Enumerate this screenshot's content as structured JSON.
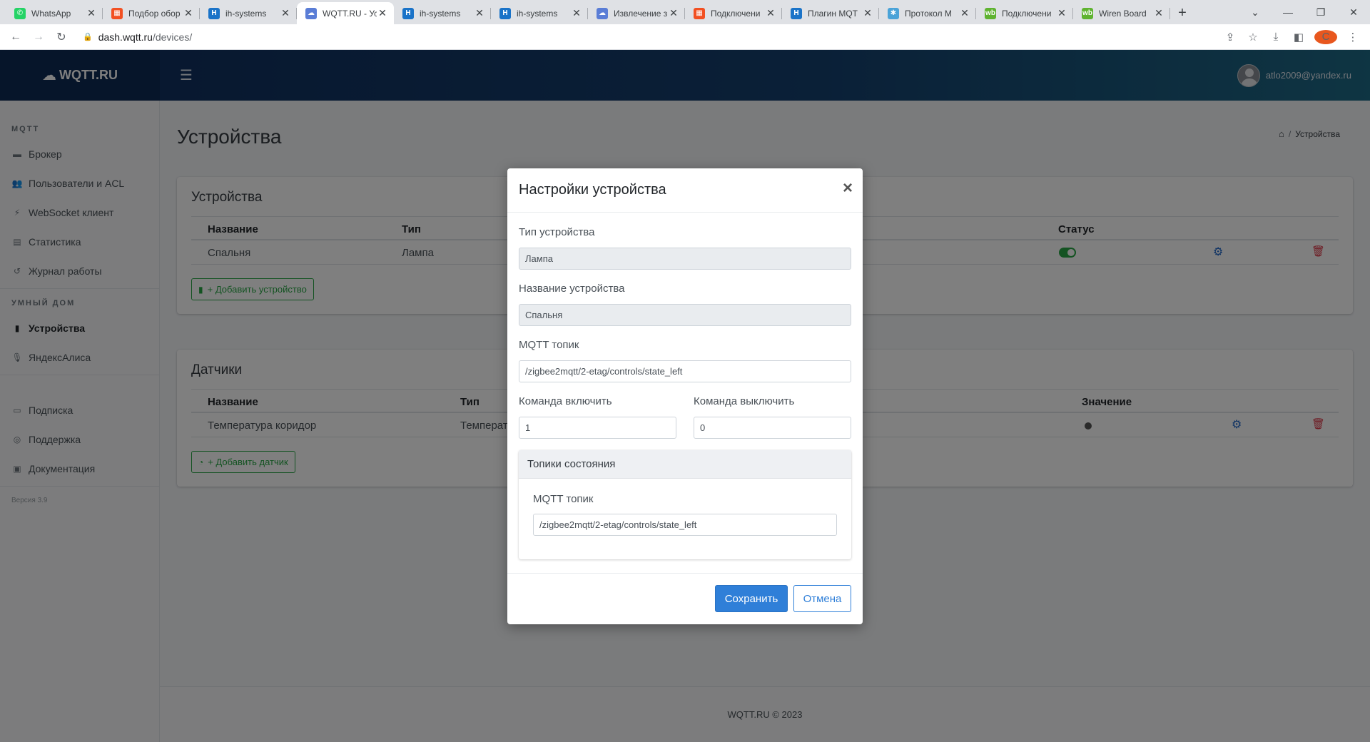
{
  "browser": {
    "tabs": [
      {
        "label": "WhatsApp",
        "icon": "whatsapp-icon",
        "color": "#25d366",
        "glyph": "✆"
      },
      {
        "label": "Подбор обор",
        "icon": "microsoft-icon",
        "color": "#f25022",
        "glyph": "▦"
      },
      {
        "label": "ih-systems",
        "icon": "h-logo-icon",
        "color": "#1a73c8",
        "glyph": "H"
      },
      {
        "label": "WQTT.RU - Ус",
        "icon": "cloud-icon",
        "color": "#5a7dd6",
        "glyph": "☁"
      },
      {
        "label": "ih-systems",
        "icon": "h-logo-icon",
        "color": "#1a73c8",
        "glyph": "H"
      },
      {
        "label": "ih-systems",
        "icon": "h-logo-icon",
        "color": "#1a73c8",
        "glyph": "H"
      },
      {
        "label": "Извлечение з",
        "icon": "cloud-icon",
        "color": "#5a7dd6",
        "glyph": "☁"
      },
      {
        "label": "Подключени",
        "icon": "microsoft-icon",
        "color": "#f25022",
        "glyph": "▦"
      },
      {
        "label": "Плагин MQT",
        "icon": "h-logo-icon",
        "color": "#1a73c8",
        "glyph": "H"
      },
      {
        "label": "Протокол М",
        "icon": "puzzle-icon",
        "color": "#4aa3d8",
        "glyph": "✱"
      },
      {
        "label": "Подключени",
        "icon": "wb-icon",
        "color": "#5fb330",
        "glyph": "wb"
      },
      {
        "label": "Wiren Board",
        "icon": "wb-icon",
        "color": "#5fb330",
        "glyph": "wb"
      }
    ],
    "active_tab": 3,
    "url_host": "dash.wqtt.ru",
    "url_path": "/devices/",
    "profile_initial": "C"
  },
  "header": {
    "brand": "WQTT.RU",
    "user_email": "atlo2009@yandex.ru"
  },
  "sidebar": {
    "sections": [
      {
        "title": "MQTT",
        "items": [
          {
            "label": "Брокер",
            "icon": "server-icon",
            "glyph": "▬",
            "active": false
          },
          {
            "label": "Пользователи и ACL",
            "icon": "users-icon",
            "glyph": "👥",
            "active": false
          },
          {
            "label": "WebSocket клиент",
            "icon": "plug-icon",
            "glyph": "⚡",
            "active": false
          },
          {
            "label": "Статистика",
            "icon": "list-icon",
            "glyph": "▤",
            "active": false
          },
          {
            "label": "Журнал работы",
            "icon": "history-icon",
            "glyph": "↺",
            "active": false
          }
        ]
      },
      {
        "title": "Умный дом",
        "items": [
          {
            "label": "Устройства",
            "icon": "microchip-icon",
            "glyph": "▮",
            "active": true
          },
          {
            "label": "ЯндексАлиса",
            "icon": "microphone-icon",
            "glyph": "🎙",
            "active": false
          }
        ]
      }
    ],
    "extra_items": [
      {
        "label": "Подписка",
        "icon": "card-icon",
        "glyph": "▭"
      },
      {
        "label": "Поддержка",
        "icon": "lifebuoy-icon",
        "glyph": "◎"
      },
      {
        "label": "Документация",
        "icon": "book-icon",
        "glyph": "▣"
      }
    ],
    "version": "Версия 3.9"
  },
  "main": {
    "page_title": "Устройства",
    "breadcrumb_current": "Устройства",
    "devices_card": {
      "title": "Устройства",
      "columns": [
        "Название",
        "Тип",
        "Статус"
      ],
      "rows": [
        {
          "name": "Спальня",
          "type": "Лампа",
          "status_on": true
        }
      ],
      "add_label": "+ Добавить устройство"
    },
    "sensors_card": {
      "title": "Датчики",
      "columns": [
        "Название",
        "Тип",
        "Значение"
      ],
      "rows": [
        {
          "name": "Температура коридор",
          "type": "Температ"
        }
      ],
      "add_label": "+ Добавить датчик"
    },
    "footer": "WQTT.RU © 2023"
  },
  "modal": {
    "title": "Настройки устройства",
    "device_type_label": "Тип устройства",
    "device_type_value": "Лампа",
    "device_name_label": "Название устройства",
    "device_name_value": "Спальня",
    "topic_label": "MQTT топик",
    "topic_value": "/zigbee2mqtt/2-etag/controls/state_left",
    "cmd_on_label": "Команда включить",
    "cmd_on_value": "1",
    "cmd_off_label": "Команда выключить",
    "cmd_off_value": "0",
    "state_topics_title": "Топики состояния",
    "state_topic_label": "MQTT топик",
    "state_topic_value": "/zigbee2mqtt/2-etag/controls/state_left",
    "save_label": "Сохранить",
    "cancel_label": "Отмена"
  },
  "colors": {
    "accent": "#2f7fd8",
    "success": "#28a745",
    "danger": "#dc3545",
    "header_dark": "#0f2d5c"
  }
}
